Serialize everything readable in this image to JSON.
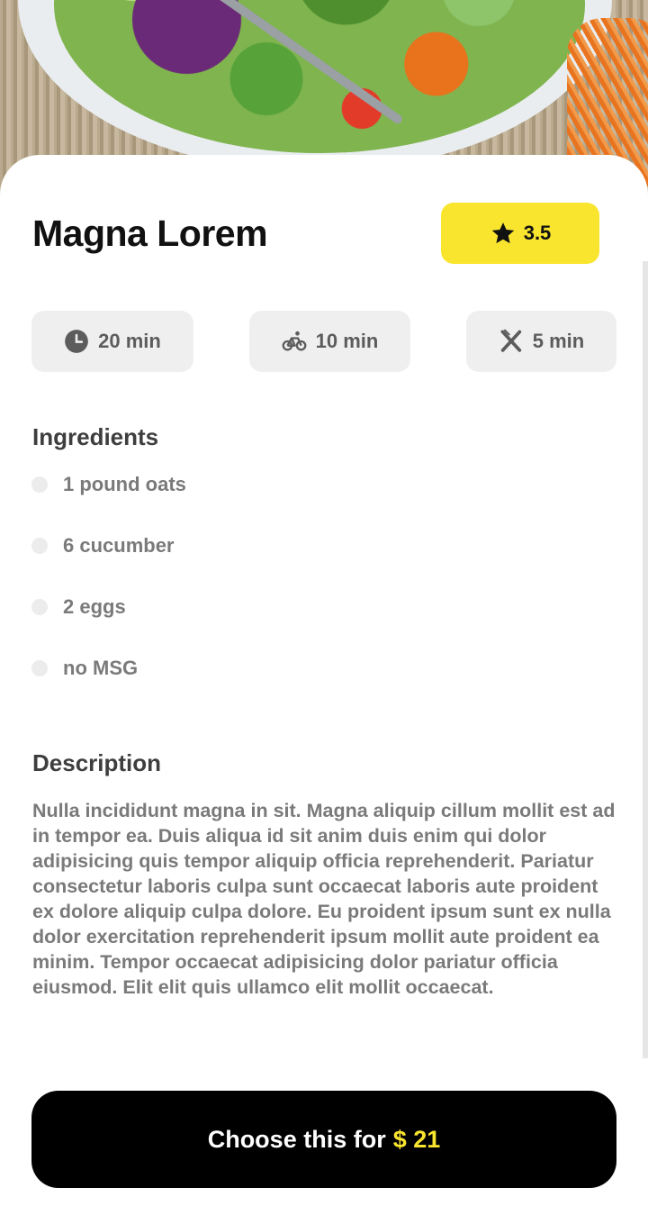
{
  "hero": {
    "image": "salad-bowl-photo"
  },
  "recipe": {
    "title": "Magna Lorem"
  },
  "rating": {
    "icon": "star-icon",
    "value": "3.5",
    "color": "#f9e52e"
  },
  "times": [
    {
      "icon": "clock-icon",
      "label": "20 min"
    },
    {
      "icon": "bike-icon",
      "label": "10 min"
    },
    {
      "icon": "utensils-icon",
      "label": "5 min"
    }
  ],
  "ingredients": {
    "heading": "Ingredients",
    "items": [
      "1 pound oats",
      "6 cucumber",
      "2 eggs",
      "no MSG"
    ]
  },
  "description": {
    "heading": "Description",
    "text": "Nulla incididunt magna in sit. Magna aliquip cillum mollit est ad in tempor ea. Duis aliqua id sit anim duis enim qui dolor adipisicing quis tempor aliquip officia reprehenderit. Pariatur consectetur laboris culpa sunt occaecat laboris aute proident ex dolore aliquip culpa dolore. Eu proident ipsum sunt ex nulla dolor exercitation reprehenderit ipsum mollit aute proident ea minim. Tempor occaecat adipisicing dolor pariatur officia eiusmod. Elit elit quis ullamco elit mollit occaecat."
  },
  "cta": {
    "label": "Choose this for",
    "price": "$ 21",
    "accent": "#f9e52e"
  }
}
